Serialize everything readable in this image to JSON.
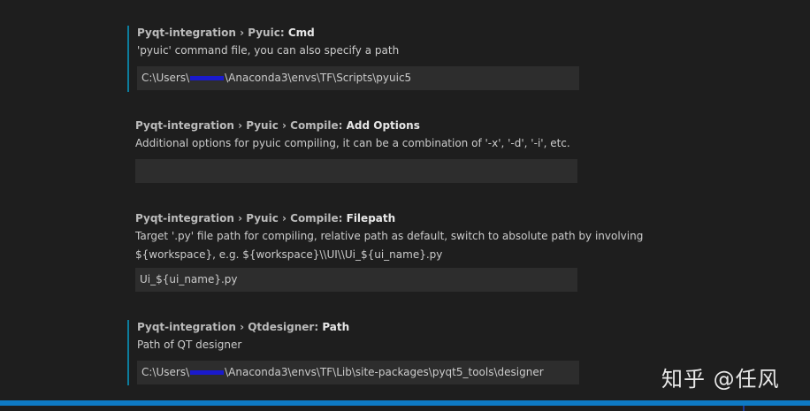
{
  "settings": [
    {
      "breadcrumb": "Pyqt-integration › Pyuic: ",
      "key": "Cmd",
      "description": "'pyuic' command file, you can also specify a path",
      "value_prefix": "C:\\Users\\",
      "value_suffix": "\\Anaconda3\\envs\\TF\\Scripts\\pyuic5"
    },
    {
      "breadcrumb": "Pyqt-integration › Pyuic › Compile: ",
      "key": "Add Options",
      "description": "Additional options for pyuic compiling, it can be a combination of '-x', '-d', '-i', etc.",
      "value": ""
    },
    {
      "breadcrumb": "Pyqt-integration › Pyuic › Compile: ",
      "key": "Filepath",
      "description": "Target '.py' file path for compiling, relative path as default, switch to absolute path by involving ${workspace}, e.g. ${workspace}\\\\UI\\\\Ui_${ui_name}.py",
      "value": "Ui_${ui_name}.py"
    },
    {
      "breadcrumb": "Pyqt-integration › Qtdesigner: ",
      "key": "Path",
      "description": "Path of QT designer",
      "value_prefix": "C:\\Users\\",
      "value_suffix": "\\Anaconda3\\envs\\TF\\Lib\\site-packages\\pyqt5_tools\\designer"
    }
  ],
  "watermark": "知乎 @任风",
  "colors": {
    "background": "#1e1e1e",
    "modified_indicator": "#0c7d9d",
    "input_background": "#2d2d2d",
    "status_bar": "#0e7ac4"
  }
}
